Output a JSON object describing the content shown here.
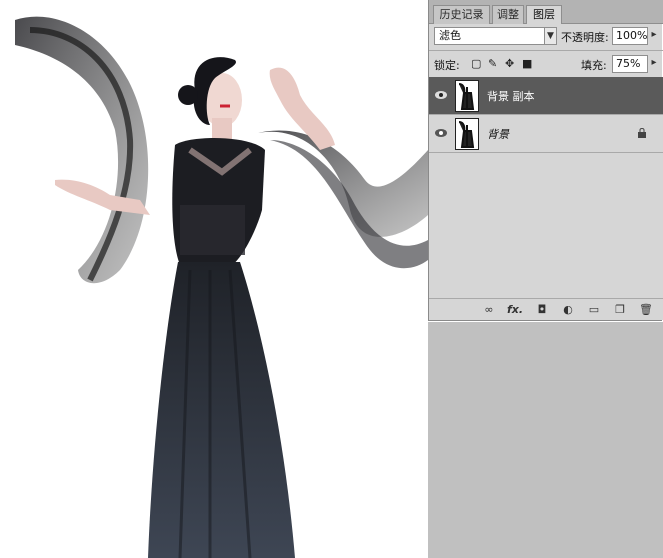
{
  "panel": {
    "tabs": [
      {
        "label": "历史记录",
        "active": false
      },
      {
        "label": "调整",
        "active": false
      },
      {
        "label": "图层",
        "active": true
      }
    ],
    "blend_mode": "滤色",
    "opacity_label": "不透明度:",
    "opacity_value": "100%",
    "lock_label": "锁定:",
    "fill_label": "填充:",
    "fill_value": "75%",
    "layers": [
      {
        "name": "背景 副本",
        "selected": true,
        "locked": false,
        "visible": true
      },
      {
        "name": "背景",
        "selected": false,
        "locked": true,
        "visible": true
      }
    ],
    "bottom_icons": [
      "link-layers-icon",
      "fx-icon",
      "add-mask-icon",
      "adjustment-layer-icon",
      "new-group-icon",
      "new-layer-icon",
      "delete-layer-icon"
    ],
    "bottom_glyphs": [
      "∞",
      "fx.",
      "◘",
      "◐",
      "▭",
      "❐",
      "🗑"
    ]
  },
  "colors": {
    "panel_bg": "#d6d6d6",
    "selected_layer": "#5a5a5a",
    "workspace": "#c0c0c0",
    "dress": "#2b2f38"
  },
  "canvas": {
    "subject": "woman in black lace dress with flowing sheer sleeves"
  }
}
